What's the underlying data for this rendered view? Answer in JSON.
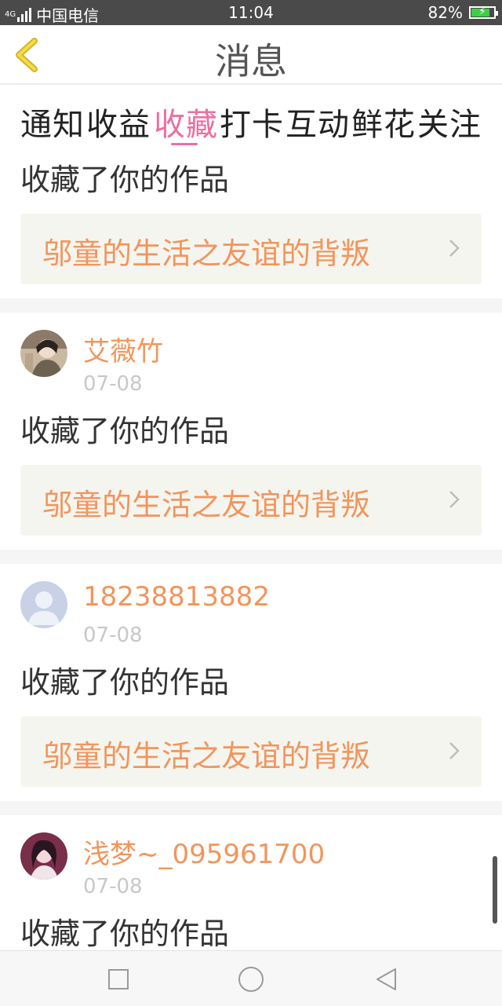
{
  "status_bar": {
    "network": "4G",
    "carrier": "中国电信",
    "time": "11:04",
    "battery": "82%",
    "battery_level": 0.82
  },
  "header": {
    "back_icon": "chevron-left-icon",
    "title": "消息"
  },
  "tabs": [
    {
      "label": "通知",
      "active": false
    },
    {
      "label": "收益",
      "active": false
    },
    {
      "label": "收藏",
      "active": true
    },
    {
      "label": "打卡",
      "active": false
    },
    {
      "label": "互动",
      "active": false
    },
    {
      "label": "鲜花",
      "active": false
    },
    {
      "label": "关注",
      "active": false
    }
  ],
  "messages": [
    {
      "action": "收藏了你的作品",
      "work_title": "邬童的生活之友谊的背叛"
    },
    {
      "user": "艾薇竹",
      "date": "07-08",
      "action": "收藏了你的作品",
      "work_title": "邬童的生活之友谊的背叛"
    },
    {
      "user": "18238813882",
      "date": "07-08",
      "action": "收藏了你的作品",
      "work_title": "邬童的生活之友谊的背叛"
    },
    {
      "user": "浅梦~_095961700",
      "date": "07-08",
      "action": "收藏了你的作品"
    }
  ],
  "nav_bar": {
    "recent_icon": "square-icon",
    "home_icon": "circle-icon",
    "back_icon": "triangle-back-icon"
  },
  "colors": {
    "accent_pink": "#ec6fa1",
    "accent_orange": "#f2955c",
    "status_bar_bg": "#4a4a4a"
  }
}
